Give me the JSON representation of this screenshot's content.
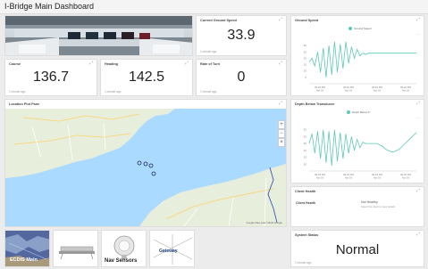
{
  "dashboard": {
    "title": "I-Bridge Main Dashboard"
  },
  "common": {
    "ago": "1 minute ago",
    "pin": "⤢",
    "menu": "⋯"
  },
  "panels": {
    "cog": {
      "title": "Current Ground Speed",
      "value": "33.9"
    },
    "course": {
      "title": "Course",
      "value": "136.7"
    },
    "heading": {
      "title": "Heading",
      "value": "142.5"
    },
    "rot": {
      "title": "Rate of Turn",
      "value": "0"
    },
    "map": {
      "title": "Location Plot Pane"
    },
    "ground_speed": {
      "title": "Ground Speed",
      "legend": "Ground Speed"
    },
    "depth": {
      "title": "Depth Below Transducer",
      "legend": "Depth Below Tr"
    },
    "client": {
      "title": "Client Health",
      "row_label": "Client Health",
      "row_value": "Not Healthy",
      "row_note": "Select the client to view details"
    },
    "system": {
      "title": "System Status",
      "value": "Normal"
    }
  },
  "tiles": {
    "ecdis": {
      "label": "ECDIS Main"
    },
    "nav": {
      "label": "Nav Sensors"
    },
    "gateway": {
      "label": "Gateway"
    }
  },
  "map_controls": {
    "zoom_in": "+",
    "zoom_out": "−",
    "close": "×"
  },
  "map_attribution": "Google  Map data ©2023 Google",
  "chart_data": [
    {
      "type": "line",
      "title": "Ground Speed",
      "series": [
        {
          "name": "Ground Speed",
          "values": [
            17,
            20,
            14,
            25,
            9,
            28,
            5,
            30,
            7,
            33,
            9,
            31,
            12,
            33,
            16,
            29,
            20,
            27,
            22,
            24,
            23,
            24,
            24,
            24,
            24,
            24,
            24,
            24,
            24,
            24,
            24,
            24,
            24,
            24,
            24,
            24,
            24,
            24,
            24
          ]
        }
      ],
      "x_tick_labels": [
        "09:18 PM\nApr 18",
        "09:19 PM\nApr 18",
        "09:19 PM\nApr 18",
        "09:20 PM\nApr 18"
      ],
      "y_tick_labels": [
        "5",
        "10",
        "15",
        "20",
        "25",
        "30"
      ],
      "ylim": [
        0,
        35
      ],
      "grid": false,
      "color": "#5cc8b8"
    },
    {
      "type": "line",
      "title": "Depth Below Transducer",
      "series": [
        {
          "name": "Depth Below Tr",
          "values": [
            25,
            32,
            18,
            34,
            14,
            35,
            11,
            34,
            9,
            35,
            12,
            33,
            14,
            32,
            18,
            30,
            20,
            28,
            22,
            26,
            25,
            25,
            25,
            25,
            25,
            24,
            23,
            21,
            20,
            19,
            19,
            20,
            21,
            23,
            25,
            27,
            29,
            31,
            33
          ]
        }
      ],
      "x_tick_labels": [
        "09:18 PM\nApr 18",
        "09:19 PM\nApr 18",
        "09:19 PM\nApr 18",
        "09:20 PM\nApr 18"
      ],
      "y_tick_labels": [
        "10",
        "15",
        "20",
        "25",
        "30",
        "35"
      ],
      "ylim": [
        5,
        40
      ],
      "grid": false,
      "color": "#5cc8b8"
    }
  ]
}
